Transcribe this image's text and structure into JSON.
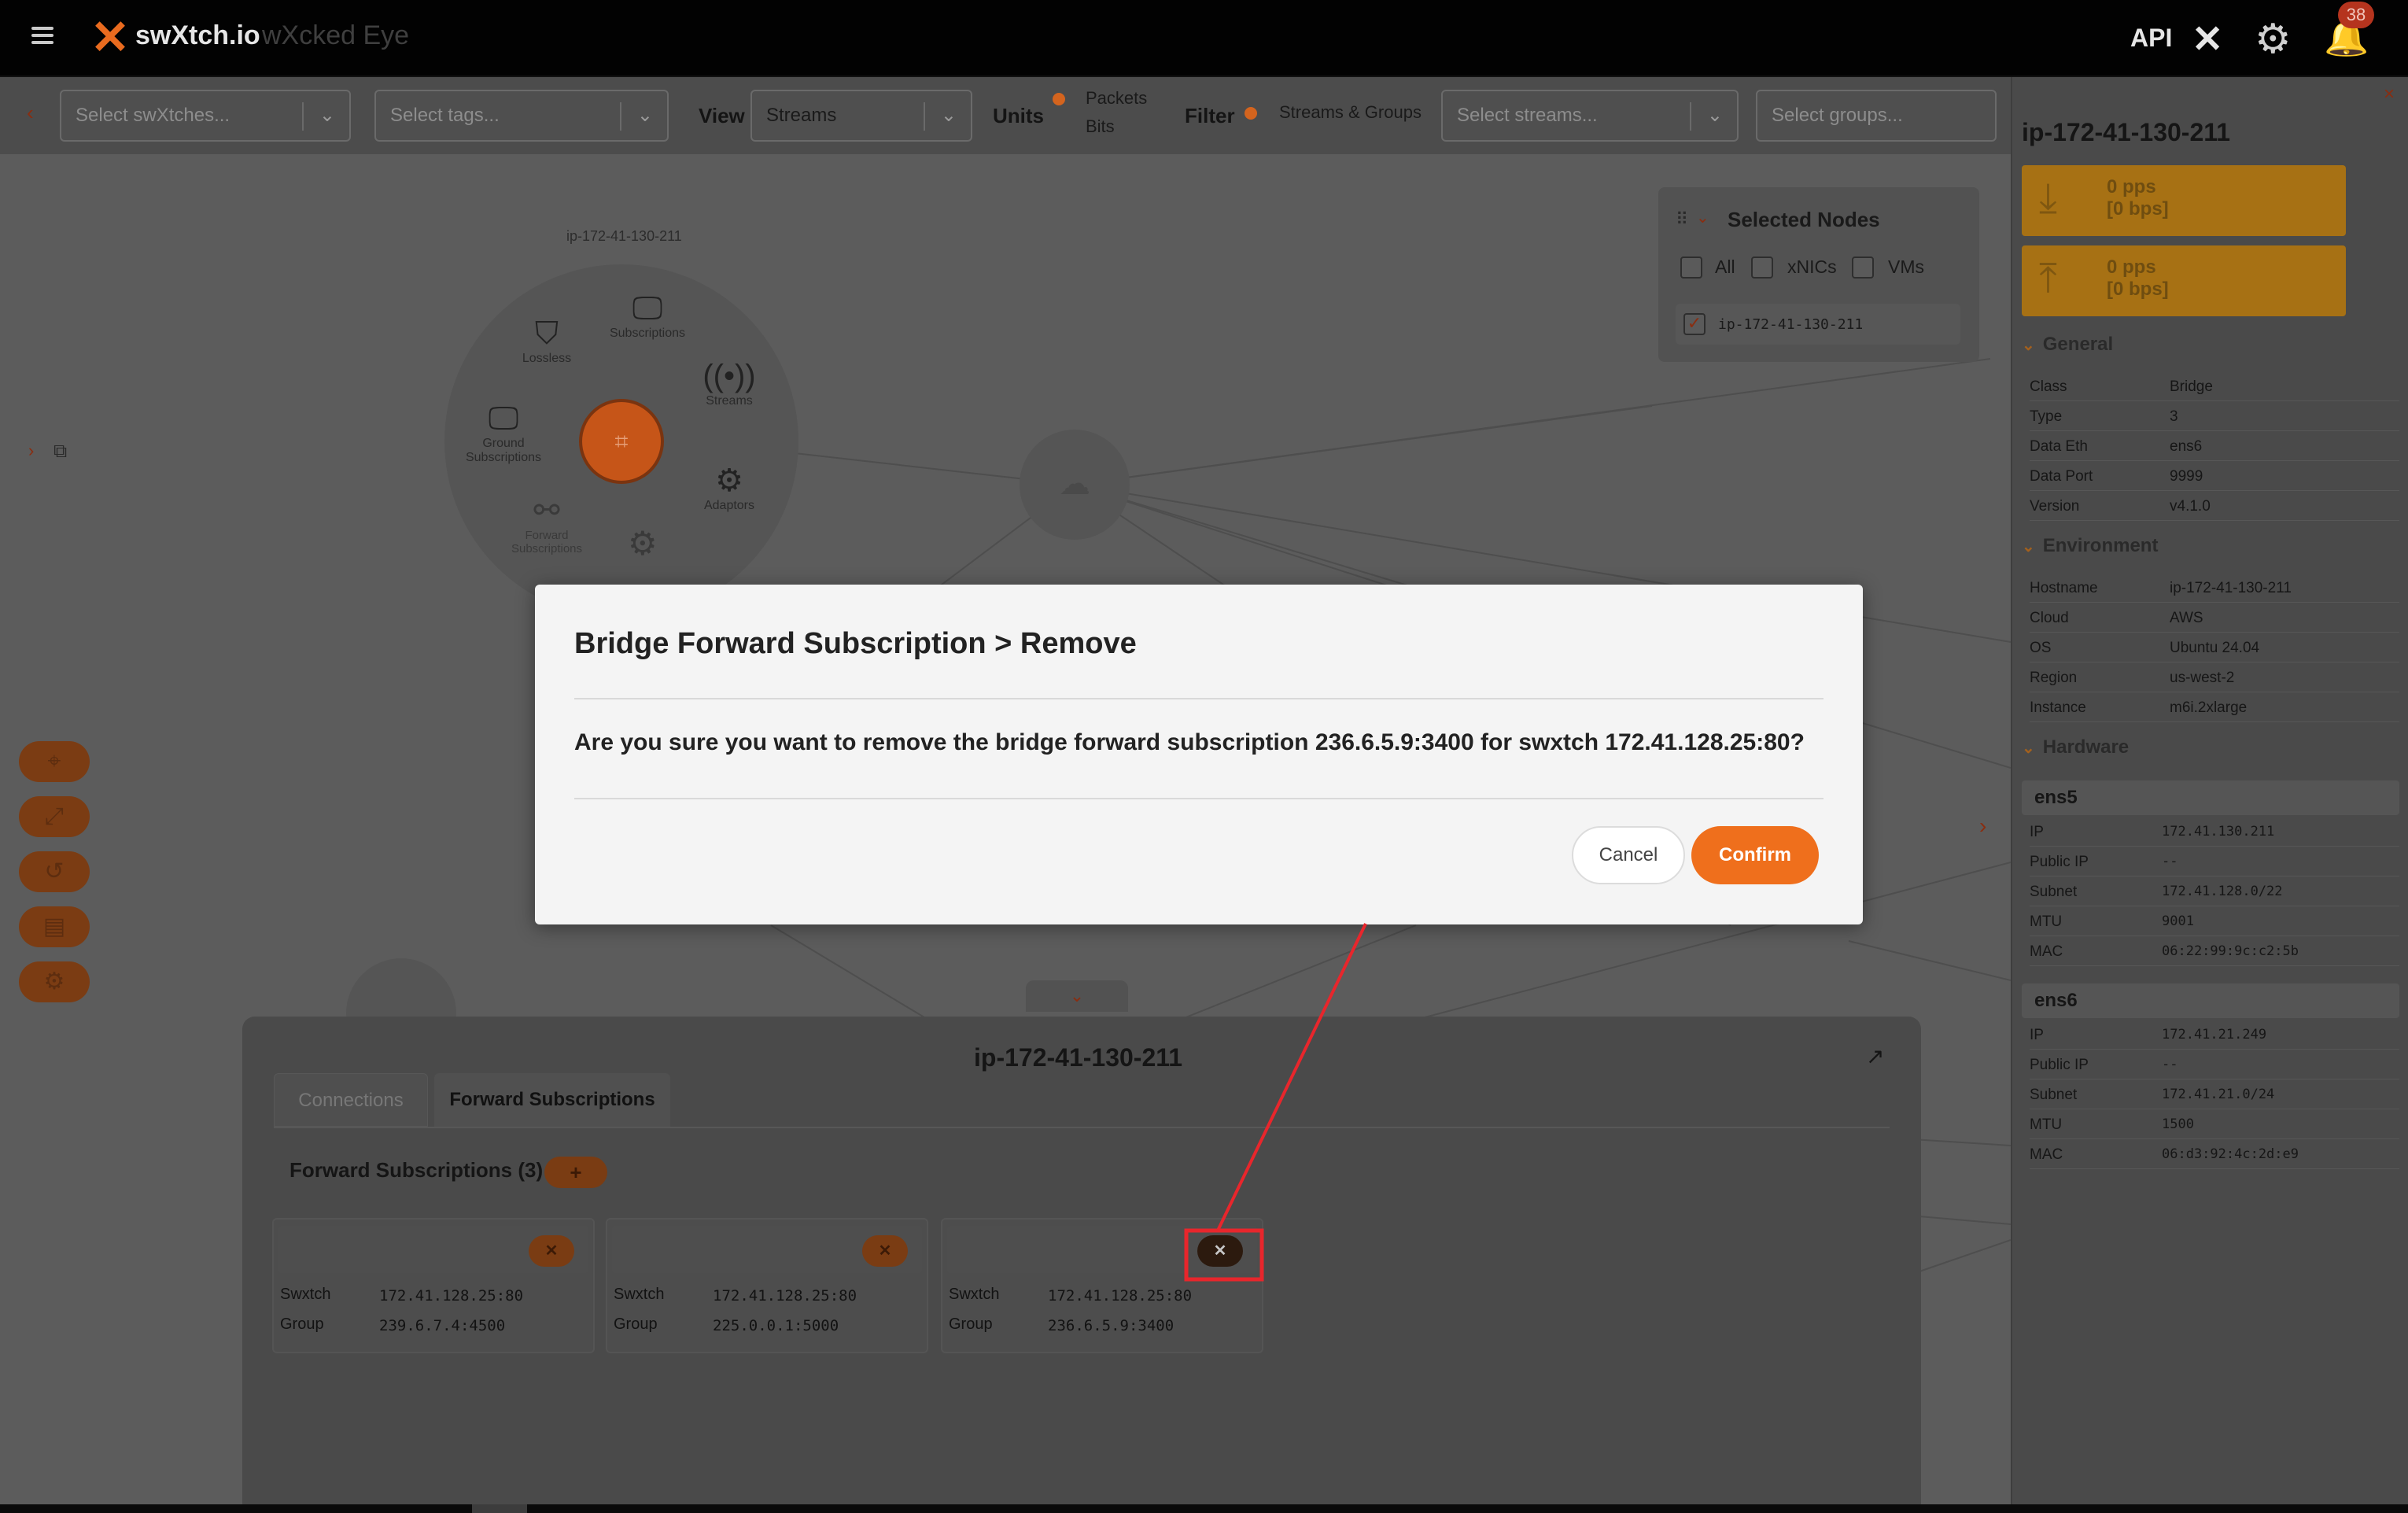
{
  "header": {
    "brand": "swXtch.io",
    "subbrand": "wXcked Eye",
    "api_label": "API",
    "notification_count": "38"
  },
  "toolbar": {
    "swxtch_placeholder": "Select swXtches...",
    "tags_placeholder": "Select tags...",
    "view_label": "View",
    "view_value": "Streams",
    "units_label": "Units",
    "units_options": [
      "Packets",
      "Bits"
    ],
    "filter_label": "Filter",
    "filter_value": "Streams & Groups",
    "streams_placeholder": "Select streams...",
    "groups_placeholder": "Select groups..."
  },
  "graph": {
    "node_label": "ip-172-41-130-211",
    "radial_items": [
      "Lossless",
      "Subscriptions",
      "Streams",
      "Ground Subscriptions",
      "Adaptors",
      "Forward Subscriptions"
    ]
  },
  "selected_nodes": {
    "title": "Selected Nodes",
    "filters": [
      "All",
      "xNICs",
      "VMs"
    ],
    "items": [
      "ip-172-41-130-211"
    ]
  },
  "right_panel": {
    "title": "ip-172-41-130-211",
    "rx_rate": [
      "0 pps",
      "[0 bps]"
    ],
    "tx_rate": [
      "0 pps",
      "[0 bps]"
    ],
    "general_label": "General",
    "general": [
      {
        "k": "Class",
        "v": "Bridge"
      },
      {
        "k": "Type",
        "v": "3"
      },
      {
        "k": "Data Eth",
        "v": "ens6"
      },
      {
        "k": "Data Port",
        "v": "9999"
      },
      {
        "k": "Version",
        "v": "v4.1.0"
      }
    ],
    "environment_label": "Environment",
    "environment": [
      {
        "k": "Hostname",
        "v": "ip-172-41-130-211"
      },
      {
        "k": "Cloud",
        "v": "AWS"
      },
      {
        "k": "OS",
        "v": "Ubuntu 24.04"
      },
      {
        "k": "Region",
        "v": "us-west-2"
      },
      {
        "k": "Instance",
        "v": "m6i.2xlarge"
      }
    ],
    "hardware_label": "Hardware",
    "interfaces": [
      {
        "name": "ens5",
        "rows": [
          {
            "k": "IP",
            "v": "172.41.130.211"
          },
          {
            "k": "Public IP",
            "v": "--"
          },
          {
            "k": "Subnet",
            "v": "172.41.128.0/22"
          },
          {
            "k": "MTU",
            "v": "9001"
          },
          {
            "k": "MAC",
            "v": "06:22:99:9c:c2:5b"
          }
        ]
      },
      {
        "name": "ens6",
        "rows": [
          {
            "k": "IP",
            "v": "172.41.21.249"
          },
          {
            "k": "Public IP",
            "v": "--"
          },
          {
            "k": "Subnet",
            "v": "172.41.21.0/24"
          },
          {
            "k": "MTU",
            "v": "1500"
          },
          {
            "k": "MAC",
            "v": "06:d3:92:4c:2d:e9"
          }
        ]
      }
    ]
  },
  "bottom_panel": {
    "title": "ip-172-41-130-211",
    "tabs": [
      "Connections",
      "Forward Subscriptions"
    ],
    "section_title": "Forward Subscriptions (3)",
    "add_label": "+",
    "swxtch_key": "Swxtch",
    "group_key": "Group",
    "cards": [
      {
        "swxtch": "172.41.128.25:80",
        "group": "239.6.7.4:4500"
      },
      {
        "swxtch": "172.41.128.25:80",
        "group": "225.0.0.1:5000"
      },
      {
        "swxtch": "172.41.128.25:80",
        "group": "236.6.5.9:3400"
      }
    ]
  },
  "modal": {
    "title": "Bridge Forward Subscription > Remove",
    "body": "Are you sure you want to remove the bridge forward subscription 236.6.5.9:3400 for swxtch 172.41.128.25:80?",
    "cancel": "Cancel",
    "confirm": "Confirm"
  },
  "colors": {
    "accent": "#ef6f1c",
    "annotation": "#e8262c"
  }
}
